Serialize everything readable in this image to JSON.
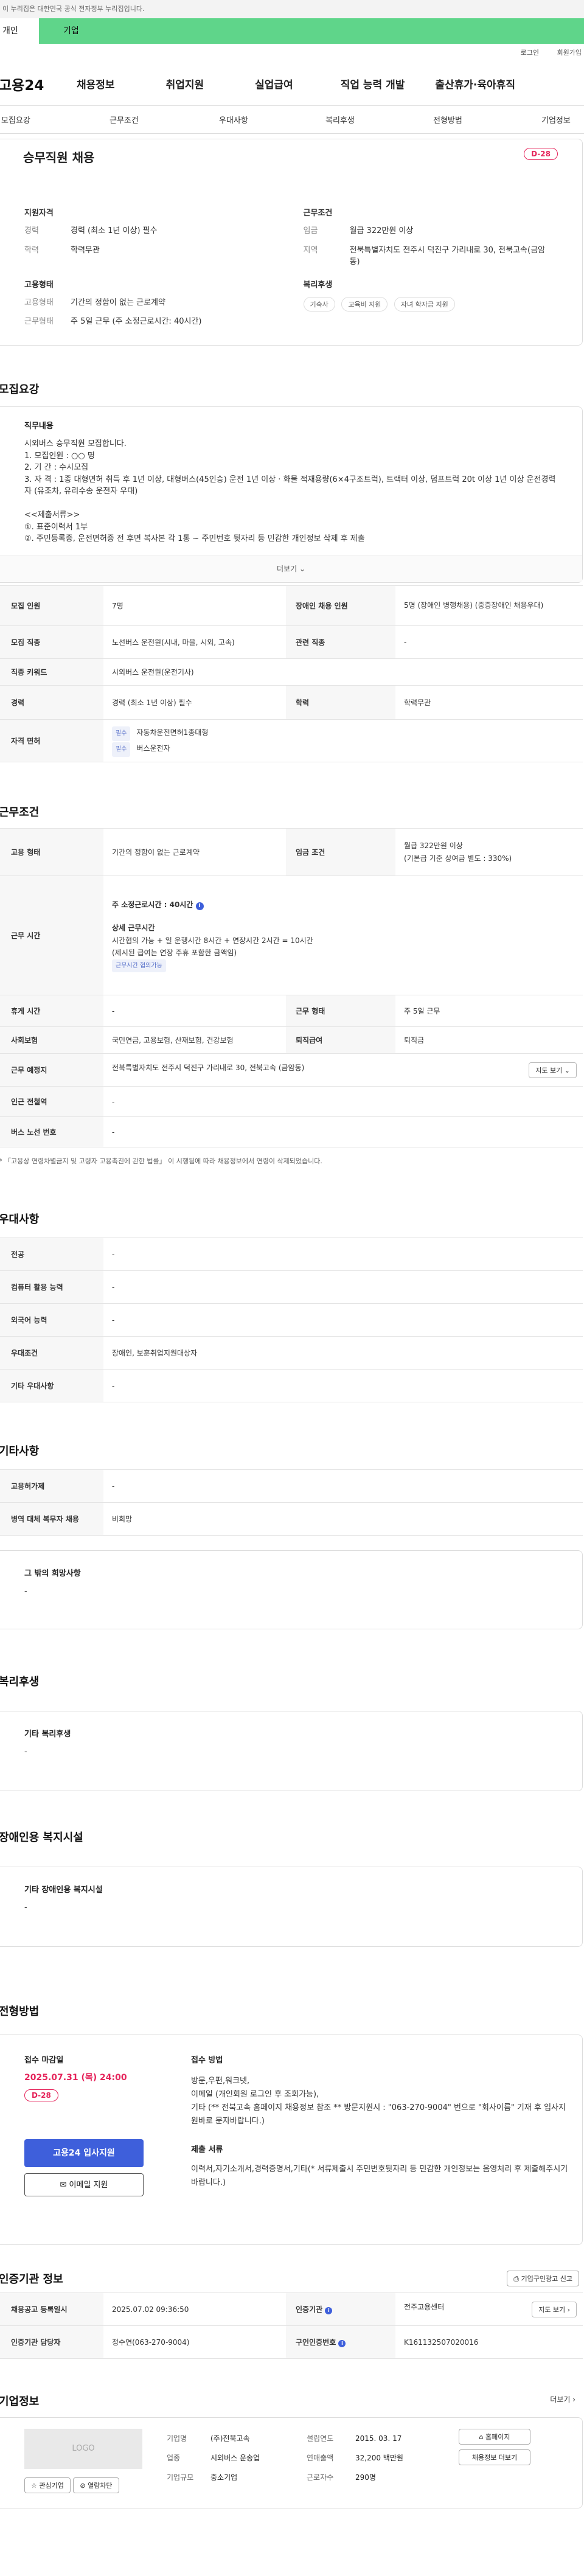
{
  "gov_banner": "이 누리집은 대한민국 공식 전자정부 누리집입니다.",
  "tabs": {
    "individual": "개인",
    "business": "기업"
  },
  "util": {
    "login": "로그인",
    "signup": "회원가입"
  },
  "logo": "고용24",
  "gnb": [
    "채용정보",
    "취업지원",
    "실업급여",
    "직업 능력 개발",
    "출산휴가·육아휴직"
  ],
  "subnav": [
    "모집요강",
    "근무조건",
    "우대사항",
    "복리후생",
    "전형방법",
    "기업정보"
  ],
  "job": {
    "title": "승무직원 채용",
    "dday": "D-28",
    "qual_title": "지원자격",
    "qual": [
      {
        "k": "경력",
        "v": "경력 (최소 1년 이상) 필수"
      },
      {
        "k": "학력",
        "v": "학력무관"
      }
    ],
    "cond_title": "근무조건",
    "cond": [
      {
        "k": "임금",
        "v": "월급 322만원 이상"
      },
      {
        "k": "지역",
        "v": "전북특별자치도 전주시 덕진구 가리내로 30, 전북고속(금암동)"
      }
    ],
    "emp_title": "고용형태",
    "emp": [
      {
        "k": "고용형태",
        "v": "기간의 정함이 없는 근로계약"
      },
      {
        "k": "근무형태",
        "v": "주 5일 근무 (주 소정근로시간: 40시간)"
      }
    ],
    "welfare_title": "복리후생",
    "welfare_pills": [
      "기숙사",
      "교육비 지원",
      "자녀 학자금 지원"
    ]
  },
  "recruit": {
    "section_title": "모집요강",
    "desc_title": "직무내용",
    "desc_text": "시외버스 승무직원 모집합니다.\n1. 모집인원 : ○○ 명\n2. 기    간 : 수시모집\n3. 자    격 : 1종 대형면허 취득 후 1년 이상, 대형버스(45인승) 운전 1년 이상 · 화물 적재용량(6×4구조트럭), 트랙터 이상, 덤프트럭 20t 이상 1년 이상 운전경력자 (유조차, 유리수송 운전자 우대)\n\n<<제출서류>>\n①. 표준이력서 1부\n②. 주민등록증, 운전면허증 전 후면 복사본 각 1통 ~ 주민번호 뒷자리 등 민감한 개인정보 삭제 후 제출",
    "more": "더보기",
    "rows": {
      "headcount_k": "모집 인원",
      "headcount_v": "7명",
      "disabled_k": "장애인 채용 인원",
      "disabled_v": "5명 (장애인 병행채용) (중증장애인 채용우대)",
      "occupation_k": "모집 직종",
      "occupation_v": "노선버스 운전원(시내, 마을, 시외, 고속)",
      "related_k": "관련 직종",
      "related_v": "-",
      "keyword_k": "직종 키워드",
      "keyword_v": "시외버스 운전원(운전기사)",
      "career_k": "경력",
      "career_v": "경력 (최소 1년 이상) 필수",
      "edu_k": "학력",
      "edu_v": "학력무관",
      "license_k": "자격 면허",
      "licenses": [
        {
          "tag": "필수",
          "name": "자동차운전면허1종대형"
        },
        {
          "tag": "필수",
          "name": "버스운전자"
        }
      ]
    }
  },
  "work": {
    "section_title": "근무조건",
    "emp_k": "고용 형태",
    "emp_v": "기간의 정함이 없는 근로계약",
    "wage_k": "임금 조건",
    "wage_v1": "월급 322만원 이상",
    "wage_v2": "(기본급 기준 상여금 별도 : 330%)",
    "hours_k": "근무 시간",
    "hours_main": "주 소정근로시간 : 40시간",
    "hours_detail_t": "상세 근무시간",
    "hours_detail_1": "시간협의 가능 + 일 운행시간 8시간 + 연장시간 2시간 = 10시간",
    "hours_detail_2": "(제시된 급여는 연장 주휴 포함한 금액임)",
    "hours_tag": "근무시간 협의가능",
    "break_k": "휴게 시간",
    "break_v": "-",
    "worktype_k": "근무 형태",
    "worktype_v": "주 5일 근무",
    "insurance_k": "사회보험",
    "insurance_v": "국민연금, 고용보험, 산재보험, 건강보험",
    "retire_k": "퇴직급여",
    "retire_v": "퇴직금",
    "place_k": "근무 예정지",
    "place_v": "전북특별자치도 전주시 덕진구 가리내로 30, 전북고속 (금암동)",
    "map_btn": "지도 보기",
    "station_k": "인근 전철역",
    "station_v": "-",
    "bus_k": "버스 노선 번호",
    "bus_v": "-",
    "note": "* 「고용상 연령차별금지 및 고령자 고용촉진에 관한 법률」 이 시행됨에 따라 채용정보에서 연령이 삭제되었습니다."
  },
  "pref": {
    "section_title": "우대사항",
    "rows": [
      {
        "k": "전공",
        "v": "-"
      },
      {
        "k": "컴퓨터 활용 능력",
        "v": "-"
      },
      {
        "k": "외국어 능력",
        "v": "-"
      },
      {
        "k": "우대조건",
        "v": "장애인, 보훈취업지원대상자"
      },
      {
        "k": "기타 우대사항",
        "v": "-"
      }
    ]
  },
  "etc": {
    "section_title": "기타사항",
    "rows": [
      {
        "k": "고용허가제",
        "v": "-"
      },
      {
        "k": "병역 대체 복무자 채용",
        "v": "비희망"
      }
    ],
    "wish_t": "그 밖의 희망사항",
    "wish_v": "-"
  },
  "welfare": {
    "section_title": "복리후생",
    "t": "기타 복리후생",
    "v": "-"
  },
  "disabled": {
    "section_title": "장애인용 복지시설",
    "t": "기타 장애인용 복지시설",
    "v": "-"
  },
  "process": {
    "section_title": "전형방법",
    "deadline_t": "접수 마감일",
    "deadline_v": "2025.07.31 (목) 24:00",
    "dday": "D-28",
    "apply_btn": "고용24 입사지원",
    "email_btn": "이메일 지원",
    "method_t": "접수 방법",
    "method_v": "방문,우편,워크넷,\n이메일 (개인회원 로그인 후 조회가능),\n기타 (** 전북고속 홈페이지 채용정보 참조 ** 방문지원시 : \"063-270-9004\" 번으로 \"회사이름\" 기재 후 입사지원바로 문자바랍니다.)",
    "docs_t": "제출 서류",
    "docs_v": "이력서,자기소개서,경력증명서,기타(* 서류제출시 주민번호뒷자리 등 민감한 개인정보는 음영처리 후 제출해주시기 바랍니다.)"
  },
  "agency": {
    "section_title": "인증기관 정보",
    "print_btn": "기업구인광고 신고",
    "reg_k": "채용공고 등록일시",
    "reg_v": "2025.07.02 09:36:50",
    "org_k": "인증기관",
    "org_v": "전주고용센터",
    "map_btn": "지도 보기",
    "mgr_k": "인증기관 담당자",
    "mgr_v": "정수연(063-270-9004)",
    "no_k": "구인인증번호",
    "no_v": "K161132507020016"
  },
  "company": {
    "section_title": "기업정보",
    "more": "더보기",
    "logo": "LOGO",
    "fav_btn": "관심기업",
    "block_btn": "열람차단",
    "rows": [
      {
        "k": "기업명",
        "v": "(주)전북고속",
        "k2": "설립연도",
        "v2": "2015. 03. 17"
      },
      {
        "k": "업종",
        "v": "시외버스 운송업",
        "k2": "연매출액",
        "v2": "32,200 백만원"
      },
      {
        "k": "기업규모",
        "v": "중소기업",
        "k2": "근로자수",
        "v2": "290명"
      }
    ],
    "home_btn": "홈페이지",
    "jobs_btn": "채용정보 더보기"
  }
}
